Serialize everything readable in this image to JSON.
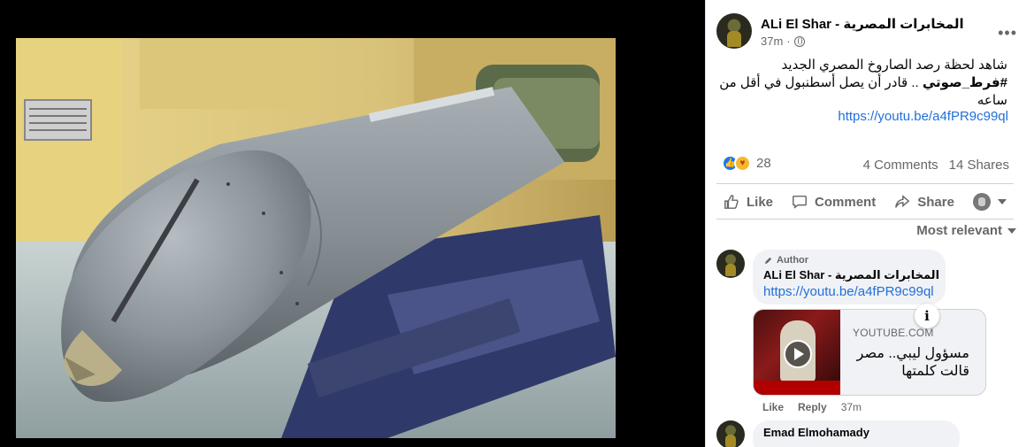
{
  "post": {
    "author": "ALi El Shar - المخابرات المصرية",
    "time": "37m",
    "text_line1": "شاهد لحظة رصد الصاروخ المصري الجديد",
    "hashtag": "#فرط_صوتي",
    "text_line2": ".. قادر أن يصل أسطنبول في أقل من ساعه",
    "link": "https://youtu.be/a4fPR9c99ql",
    "more_icon": "more-dots-icon"
  },
  "stats": {
    "reaction_count": "28",
    "comments": "4 Comments",
    "shares": "14 Shares"
  },
  "actions": {
    "like": "Like",
    "comment": "Comment",
    "share": "Share"
  },
  "sort_label": "Most relevant",
  "comments": [
    {
      "badge": "Author",
      "name": "ALi El Shar - المخابرات المصرية",
      "link": "https://youtu.be/a4fPR9c99ql",
      "preview_source": "YOUTUBE.COM",
      "preview_title": "مسؤول ليبي.. مصر قالت كلمتها",
      "like": "Like",
      "reply": "Reply",
      "time": "37m"
    },
    {
      "name": "Emad Elmohamady"
    }
  ],
  "colors": {
    "link": "#216fdb",
    "like_blue": "#1877f2",
    "bubble": "#f0f2f5"
  }
}
